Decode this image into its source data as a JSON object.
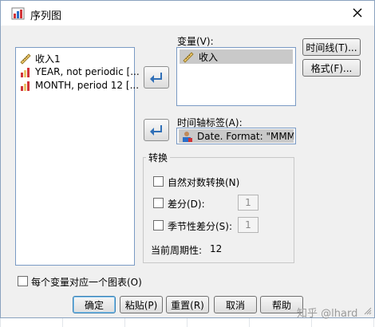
{
  "window": {
    "title": "序列图"
  },
  "variables_list": {
    "items": [
      {
        "label": "收入1",
        "icon": "ruler-icon"
      },
      {
        "label": "YEAR, not periodic [...",
        "icon": "bar-chart-icon"
      },
      {
        "label": "MONTH, period 12 [...",
        "icon": "bar-chart-icon"
      }
    ]
  },
  "variables_target": {
    "label": "变量(V):",
    "items": [
      {
        "label": "收入",
        "icon": "ruler-icon"
      }
    ]
  },
  "time_axis": {
    "label": "时间轴标签(A):",
    "value": "Date.  Format:  \"MMM..."
  },
  "side_buttons": {
    "time_lines": "时间线(T)...",
    "format": "格式(F)..."
  },
  "transform": {
    "title": "转换",
    "natural_log": "自然对数转换(N)",
    "difference": "差分(D):",
    "difference_value": "1",
    "seasonal_difference": "季节性差分(S):",
    "seasonal_value": "1",
    "current_periodicity_label": "当前周期性:",
    "current_periodicity_value": "12"
  },
  "one_chart_per_variable": "每个变量对应一个图表(O)",
  "buttons": {
    "ok": "确定",
    "paste": "粘贴(P)",
    "reset": "重置(R)",
    "cancel": "取消",
    "help": "帮助"
  },
  "watermark": "知乎 @lhard"
}
